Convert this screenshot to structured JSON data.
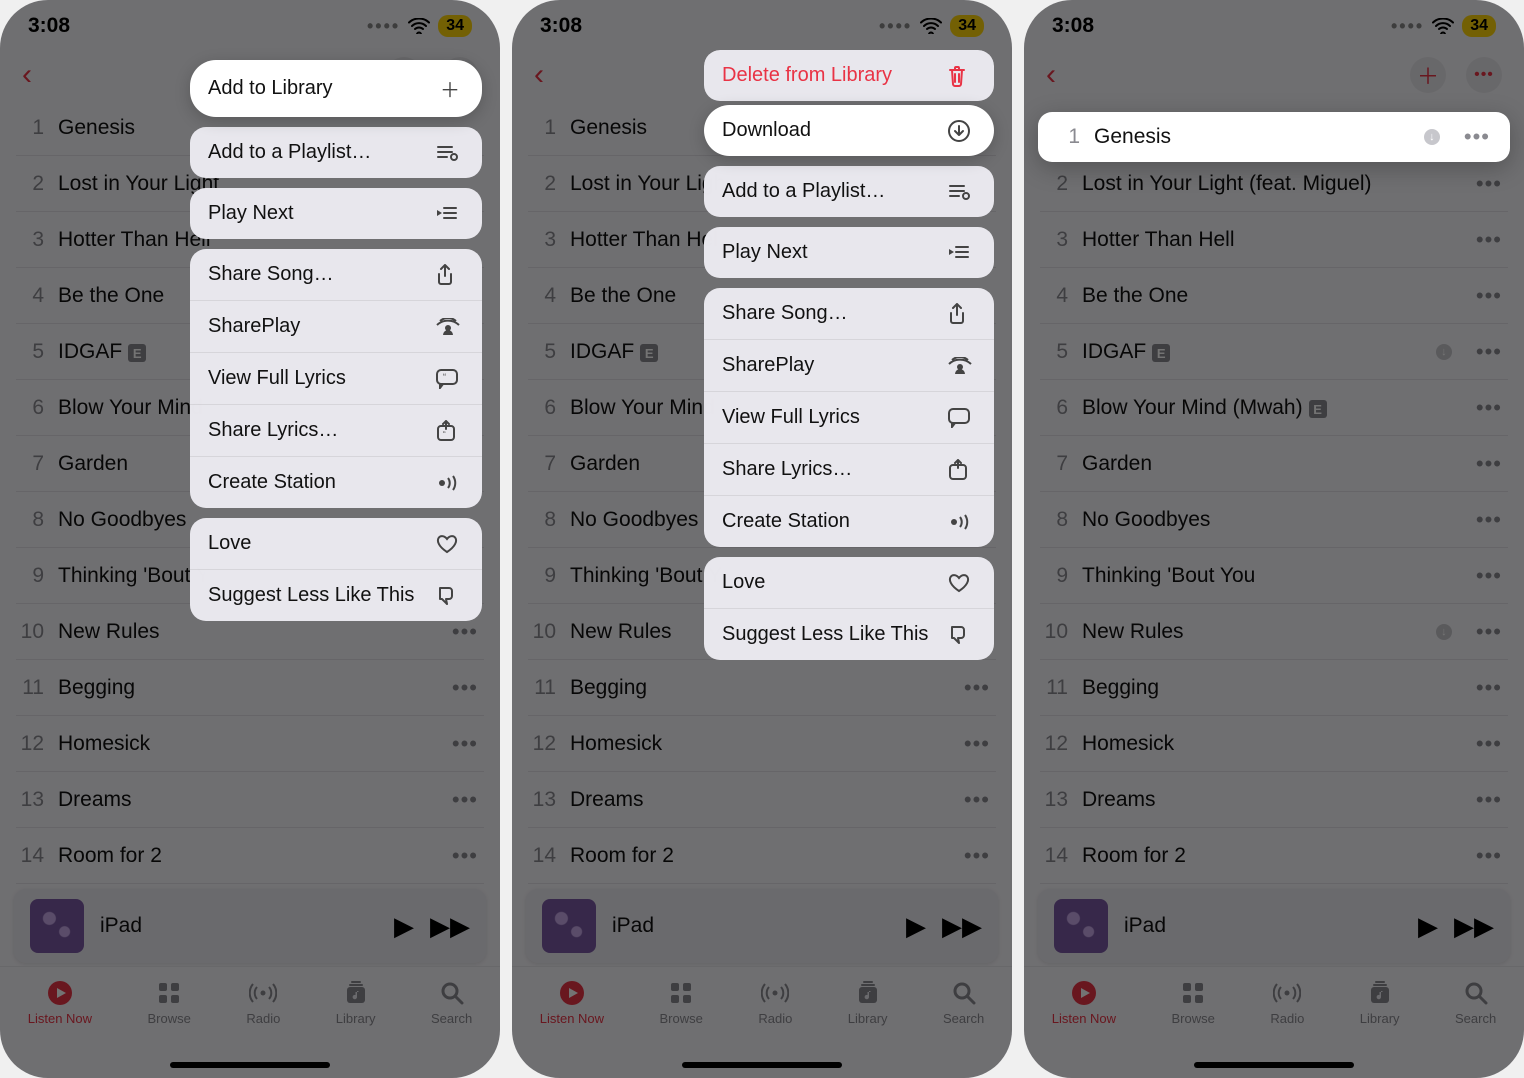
{
  "status": {
    "time": "3:08",
    "battery": "34"
  },
  "nav": {
    "add_glyph": "＋",
    "more_glyph": "•••"
  },
  "songs": [
    {
      "n": "1",
      "title": "Genesis",
      "more": true,
      "dl_dot": true
    },
    {
      "n": "2",
      "title": "Lost in Your Light (feat. Miguel)",
      "more": true
    },
    {
      "n": "3",
      "title": "Hotter Than Hell",
      "more": true
    },
    {
      "n": "4",
      "title": "Be the One",
      "more": true
    },
    {
      "n": "5",
      "title": "IDGAF",
      "more": true,
      "explicit": true,
      "dl_dot": true
    },
    {
      "n": "6",
      "title": "Blow Your Mind (Mwah)",
      "more": true,
      "explicit": true
    },
    {
      "n": "7",
      "title": "Garden",
      "more": true
    },
    {
      "n": "8",
      "title": "No Goodbyes",
      "more": true
    },
    {
      "n": "9",
      "title": "Thinking 'Bout You",
      "more": true
    },
    {
      "n": "10",
      "title": "New Rules",
      "more": true,
      "dl_dot": true
    },
    {
      "n": "11",
      "title": "Begging",
      "more": true
    },
    {
      "n": "12",
      "title": "Homesick",
      "more": true
    },
    {
      "n": "13",
      "title": "Dreams",
      "more": true
    },
    {
      "n": "14",
      "title": "Room for 2",
      "more": true
    }
  ],
  "songs_short": {
    "2": "Lost in Your Light",
    "3": "Hotter Than Hell",
    "6": "Blow Your Mind",
    "9": "Thinking 'Bout Y"
  },
  "songs_short2": {
    "2": "Lost in Your Ligh",
    "3": "Hotter Than Hel",
    "6": "Blow Your Mind",
    "9": "Thinking 'Bout Y"
  },
  "mini": {
    "title": "iPad"
  },
  "tabs": {
    "listen": "Listen Now",
    "browse": "Browse",
    "radio": "Radio",
    "library": "Library",
    "search": "Search"
  },
  "menu1": {
    "add_library": "Add to Library",
    "add_playlist": "Add to a Playlist…",
    "play_next": "Play Next",
    "share_song": "Share Song…",
    "shareplay": "SharePlay",
    "view_lyrics": "View Full Lyrics",
    "share_lyrics": "Share Lyrics…",
    "create_station": "Create Station",
    "love": "Love",
    "suggest_less": "Suggest Less Like This"
  },
  "menu2": {
    "delete": "Delete from Library",
    "download": "Download",
    "add_playlist": "Add to a Playlist…",
    "play_next": "Play Next",
    "share_song": "Share Song…",
    "shareplay": "SharePlay",
    "view_lyrics": "View Full Lyrics",
    "share_lyrics": "Share Lyrics…",
    "create_station": "Create Station",
    "love": "Love",
    "suggest_less": "Suggest Less Like This"
  },
  "hl3": {
    "n": "1",
    "title": "Genesis"
  }
}
